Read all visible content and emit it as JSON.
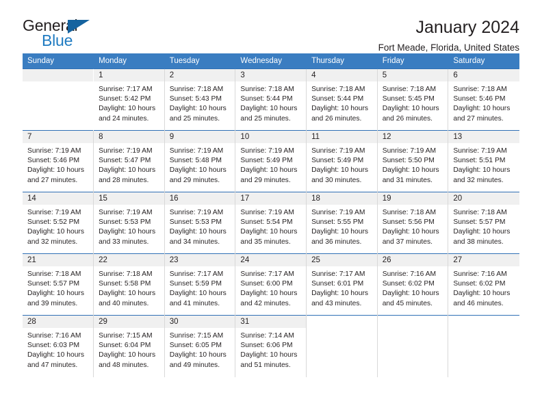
{
  "brand": {
    "name_dark": "General",
    "name_blue": "Blue",
    "accent_color": "#1f7bc1",
    "triangle_color": "#15639f"
  },
  "header": {
    "title": "January 2024",
    "subtitle": "Fort Meade, Florida, United States"
  },
  "calendar": {
    "header_bg": "#3a7dc1",
    "daynum_bg": "#f0f0f0",
    "weekdays": [
      "Sunday",
      "Monday",
      "Tuesday",
      "Wednesday",
      "Thursday",
      "Friday",
      "Saturday"
    ],
    "weeks": [
      [
        {
          "day": "",
          "sunrise": "",
          "sunset": "",
          "daylight1": "",
          "daylight2": "",
          "empty": true
        },
        {
          "day": "1",
          "sunrise": "Sunrise: 7:17 AM",
          "sunset": "Sunset: 5:42 PM",
          "daylight1": "Daylight: 10 hours",
          "daylight2": "and 24 minutes."
        },
        {
          "day": "2",
          "sunrise": "Sunrise: 7:18 AM",
          "sunset": "Sunset: 5:43 PM",
          "daylight1": "Daylight: 10 hours",
          "daylight2": "and 25 minutes."
        },
        {
          "day": "3",
          "sunrise": "Sunrise: 7:18 AM",
          "sunset": "Sunset: 5:44 PM",
          "daylight1": "Daylight: 10 hours",
          "daylight2": "and 25 minutes."
        },
        {
          "day": "4",
          "sunrise": "Sunrise: 7:18 AM",
          "sunset": "Sunset: 5:44 PM",
          "daylight1": "Daylight: 10 hours",
          "daylight2": "and 26 minutes."
        },
        {
          "day": "5",
          "sunrise": "Sunrise: 7:18 AM",
          "sunset": "Sunset: 5:45 PM",
          "daylight1": "Daylight: 10 hours",
          "daylight2": "and 26 minutes."
        },
        {
          "day": "6",
          "sunrise": "Sunrise: 7:18 AM",
          "sunset": "Sunset: 5:46 PM",
          "daylight1": "Daylight: 10 hours",
          "daylight2": "and 27 minutes."
        }
      ],
      [
        {
          "day": "7",
          "sunrise": "Sunrise: 7:19 AM",
          "sunset": "Sunset: 5:46 PM",
          "daylight1": "Daylight: 10 hours",
          "daylight2": "and 27 minutes."
        },
        {
          "day": "8",
          "sunrise": "Sunrise: 7:19 AM",
          "sunset": "Sunset: 5:47 PM",
          "daylight1": "Daylight: 10 hours",
          "daylight2": "and 28 minutes."
        },
        {
          "day": "9",
          "sunrise": "Sunrise: 7:19 AM",
          "sunset": "Sunset: 5:48 PM",
          "daylight1": "Daylight: 10 hours",
          "daylight2": "and 29 minutes."
        },
        {
          "day": "10",
          "sunrise": "Sunrise: 7:19 AM",
          "sunset": "Sunset: 5:49 PM",
          "daylight1": "Daylight: 10 hours",
          "daylight2": "and 29 minutes."
        },
        {
          "day": "11",
          "sunrise": "Sunrise: 7:19 AM",
          "sunset": "Sunset: 5:49 PM",
          "daylight1": "Daylight: 10 hours",
          "daylight2": "and 30 minutes."
        },
        {
          "day": "12",
          "sunrise": "Sunrise: 7:19 AM",
          "sunset": "Sunset: 5:50 PM",
          "daylight1": "Daylight: 10 hours",
          "daylight2": "and 31 minutes."
        },
        {
          "day": "13",
          "sunrise": "Sunrise: 7:19 AM",
          "sunset": "Sunset: 5:51 PM",
          "daylight1": "Daylight: 10 hours",
          "daylight2": "and 32 minutes."
        }
      ],
      [
        {
          "day": "14",
          "sunrise": "Sunrise: 7:19 AM",
          "sunset": "Sunset: 5:52 PM",
          "daylight1": "Daylight: 10 hours",
          "daylight2": "and 32 minutes."
        },
        {
          "day": "15",
          "sunrise": "Sunrise: 7:19 AM",
          "sunset": "Sunset: 5:53 PM",
          "daylight1": "Daylight: 10 hours",
          "daylight2": "and 33 minutes."
        },
        {
          "day": "16",
          "sunrise": "Sunrise: 7:19 AM",
          "sunset": "Sunset: 5:53 PM",
          "daylight1": "Daylight: 10 hours",
          "daylight2": "and 34 minutes."
        },
        {
          "day": "17",
          "sunrise": "Sunrise: 7:19 AM",
          "sunset": "Sunset: 5:54 PM",
          "daylight1": "Daylight: 10 hours",
          "daylight2": "and 35 minutes."
        },
        {
          "day": "18",
          "sunrise": "Sunrise: 7:19 AM",
          "sunset": "Sunset: 5:55 PM",
          "daylight1": "Daylight: 10 hours",
          "daylight2": "and 36 minutes."
        },
        {
          "day": "19",
          "sunrise": "Sunrise: 7:18 AM",
          "sunset": "Sunset: 5:56 PM",
          "daylight1": "Daylight: 10 hours",
          "daylight2": "and 37 minutes."
        },
        {
          "day": "20",
          "sunrise": "Sunrise: 7:18 AM",
          "sunset": "Sunset: 5:57 PM",
          "daylight1": "Daylight: 10 hours",
          "daylight2": "and 38 minutes."
        }
      ],
      [
        {
          "day": "21",
          "sunrise": "Sunrise: 7:18 AM",
          "sunset": "Sunset: 5:57 PM",
          "daylight1": "Daylight: 10 hours",
          "daylight2": "and 39 minutes."
        },
        {
          "day": "22",
          "sunrise": "Sunrise: 7:18 AM",
          "sunset": "Sunset: 5:58 PM",
          "daylight1": "Daylight: 10 hours",
          "daylight2": "and 40 minutes."
        },
        {
          "day": "23",
          "sunrise": "Sunrise: 7:17 AM",
          "sunset": "Sunset: 5:59 PM",
          "daylight1": "Daylight: 10 hours",
          "daylight2": "and 41 minutes."
        },
        {
          "day": "24",
          "sunrise": "Sunrise: 7:17 AM",
          "sunset": "Sunset: 6:00 PM",
          "daylight1": "Daylight: 10 hours",
          "daylight2": "and 42 minutes."
        },
        {
          "day": "25",
          "sunrise": "Sunrise: 7:17 AM",
          "sunset": "Sunset: 6:01 PM",
          "daylight1": "Daylight: 10 hours",
          "daylight2": "and 43 minutes."
        },
        {
          "day": "26",
          "sunrise": "Sunrise: 7:16 AM",
          "sunset": "Sunset: 6:02 PM",
          "daylight1": "Daylight: 10 hours",
          "daylight2": "and 45 minutes."
        },
        {
          "day": "27",
          "sunrise": "Sunrise: 7:16 AM",
          "sunset": "Sunset: 6:02 PM",
          "daylight1": "Daylight: 10 hours",
          "daylight2": "and 46 minutes."
        }
      ],
      [
        {
          "day": "28",
          "sunrise": "Sunrise: 7:16 AM",
          "sunset": "Sunset: 6:03 PM",
          "daylight1": "Daylight: 10 hours",
          "daylight2": "and 47 minutes."
        },
        {
          "day": "29",
          "sunrise": "Sunrise: 7:15 AM",
          "sunset": "Sunset: 6:04 PM",
          "daylight1": "Daylight: 10 hours",
          "daylight2": "and 48 minutes."
        },
        {
          "day": "30",
          "sunrise": "Sunrise: 7:15 AM",
          "sunset": "Sunset: 6:05 PM",
          "daylight1": "Daylight: 10 hours",
          "daylight2": "and 49 minutes."
        },
        {
          "day": "31",
          "sunrise": "Sunrise: 7:14 AM",
          "sunset": "Sunset: 6:06 PM",
          "daylight1": "Daylight: 10 hours",
          "daylight2": "and 51 minutes."
        },
        {
          "day": "",
          "sunrise": "",
          "sunset": "",
          "daylight1": "",
          "daylight2": "",
          "nodata": true
        },
        {
          "day": "",
          "sunrise": "",
          "sunset": "",
          "daylight1": "",
          "daylight2": "",
          "nodata": true
        },
        {
          "day": "",
          "sunrise": "",
          "sunset": "",
          "daylight1": "",
          "daylight2": "",
          "nodata": true
        }
      ]
    ]
  }
}
